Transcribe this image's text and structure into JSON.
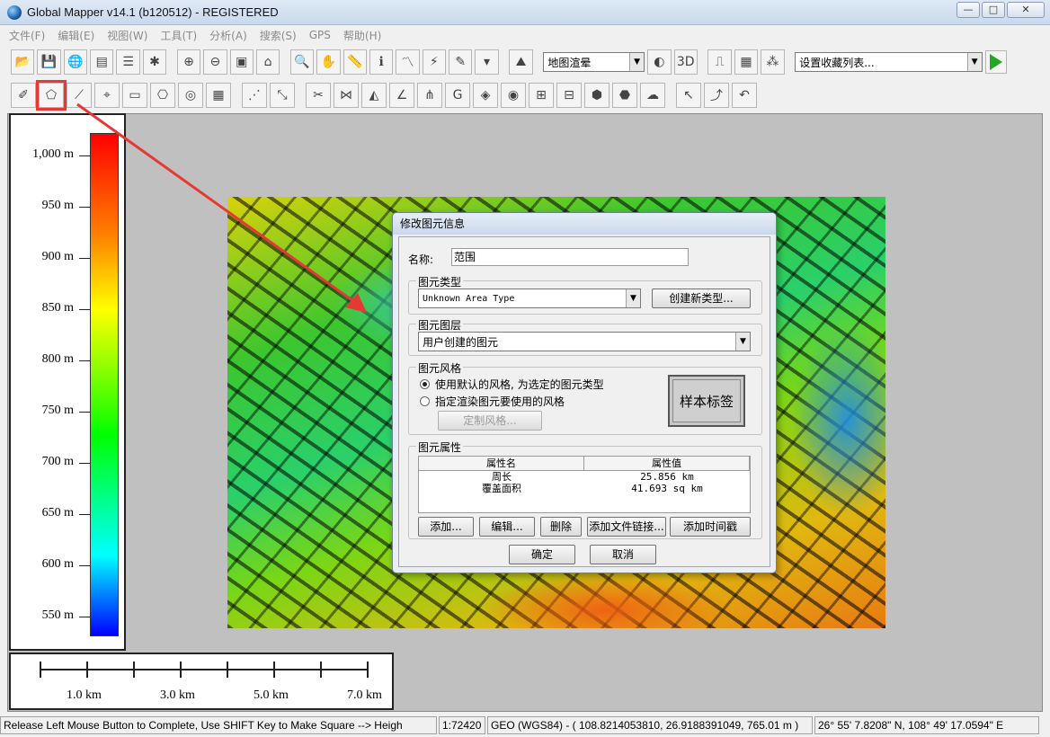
{
  "window": {
    "title": "Global Mapper v14.1 (b120512) - REGISTERED",
    "minimize": "—",
    "maximize": "□",
    "close": "✕"
  },
  "menu": [
    "文件(F)",
    "编辑(E)",
    "视图(W)",
    "工具(T)",
    "分析(A)",
    "搜索(S)",
    "GPS",
    "帮助(H)"
  ],
  "toolbar1": {
    "render_mode": "地图渲晕",
    "favorites": "设置收藏列表..."
  },
  "legend": {
    "ticks": [
      "1,000 m",
      "950 m",
      "900 m",
      "850 m",
      "800 m",
      "750 m",
      "700 m",
      "650 m",
      "600 m",
      "550 m"
    ]
  },
  "scale": {
    "labels": [
      "1.0 km",
      "3.0 km",
      "5.0 km",
      "7.0 km"
    ]
  },
  "dialog": {
    "title": "修改图元信息",
    "name_label": "名称:",
    "name_value": "范围",
    "type_group": "图元类型",
    "type_value": "Unknown Area Type",
    "create_type_button": "创建新类型...",
    "layer_group": "图元图层",
    "layer_value": "用户创建的图元",
    "style_group": "图元风格",
    "style_default": "使用默认的风格, 为选定的图元类型",
    "style_custom": "指定渲染图元要使用的风格",
    "custom_style_button": "定制风格...",
    "sample_label": "样本标签",
    "attr_group": "图元属性",
    "attr_headers": [
      "属性名",
      "属性值"
    ],
    "attr_rows": [
      {
        "name": "周长",
        "value": "25.856 km"
      },
      {
        "name": "覆盖面积",
        "value": "41.693 sq km"
      }
    ],
    "add_button": "添加...",
    "edit_button": "编辑...",
    "delete_button": "删除",
    "add_file_link_button": "添加文件链接...",
    "add_timestamp_button": "添加时间戳",
    "ok_button": "确定",
    "cancel_button": "取消"
  },
  "status": {
    "hint": "Release Left Mouse Button to Complete, Use SHIFT Key to Make Square --> Heigh",
    "scale": "1:72420",
    "coords": "GEO (WGS84) - ( 108.8214053810, 26.9188391049, 765.01 m )",
    "dms": "26° 55' 7.8208\" N, 108° 49' 17.0594\" E"
  },
  "colors": {
    "highlight": "#e53935",
    "arrow": "#e53935"
  }
}
